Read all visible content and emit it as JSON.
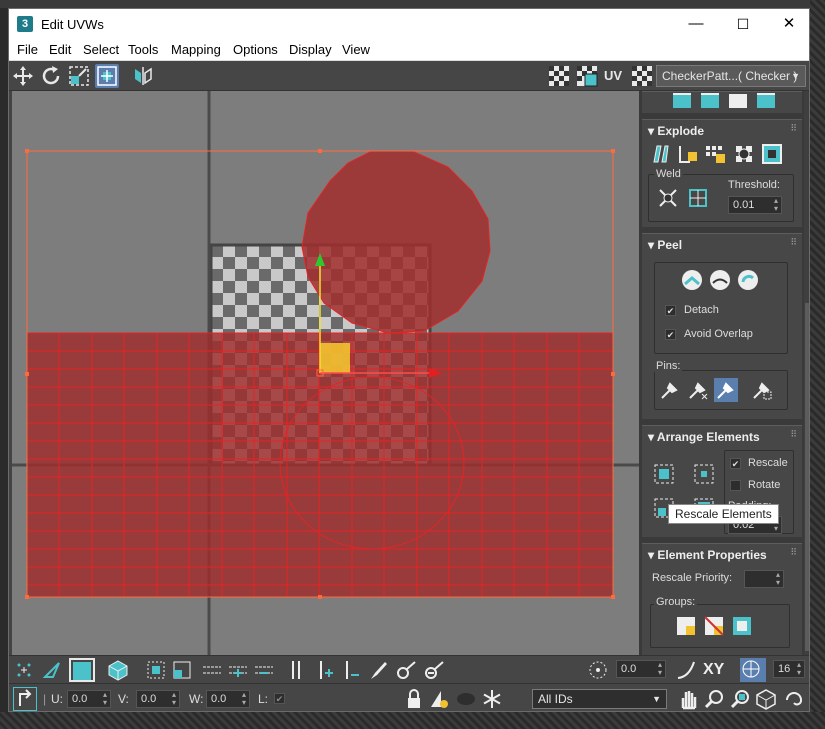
{
  "window": {
    "title": "Edit UVWs",
    "app_icon": "3",
    "min": "—",
    "max": "☐",
    "close": "✕"
  },
  "menubar": {
    "items": [
      "File",
      "Edit",
      "Select",
      "Tools",
      "Mapping",
      "Options",
      "Display",
      "View"
    ]
  },
  "toolbar": {
    "uv_label": "UV",
    "texture_dropdown": "CheckerPatt...( Checker )"
  },
  "panel": {
    "explode": {
      "title": "Explode",
      "weld_label": "Weld",
      "threshold_label": "Threshold:",
      "threshold_value": "0.01"
    },
    "peel": {
      "title": "Peel",
      "detach_label": "Detach",
      "detach_checked": true,
      "avoid_overlap_label": "Avoid Overlap",
      "avoid_overlap_checked": true,
      "pins_label": "Pins:"
    },
    "arrange": {
      "title": "Arrange Elements",
      "rescale_label": "Rescale",
      "rescale_checked": true,
      "rotate_label": "Rotate",
      "rotate_checked": false,
      "padding_label": "Padding:",
      "padding_value": "0.02"
    },
    "element_props": {
      "title": "Element Properties",
      "rescale_priority_label": "Rescale Priority:",
      "rescale_priority_value": "",
      "groups_label": "Groups:"
    }
  },
  "tooltip": "Rescale Elements",
  "bottombar": {
    "value_field": "0.0",
    "xy_label": "XY",
    "grid_value": "16"
  },
  "statusbar": {
    "u_label": "U:",
    "u_value": "0.0",
    "v_label": "V:",
    "v_value": "0.0",
    "w_label": "W:",
    "w_value": "0.0",
    "l_label": "L:",
    "ids_dropdown": "All IDs"
  },
  "colors": {
    "accent": "#4bc2c9",
    "uv_red": "#b52a2a",
    "selection": "#f2c230"
  }
}
